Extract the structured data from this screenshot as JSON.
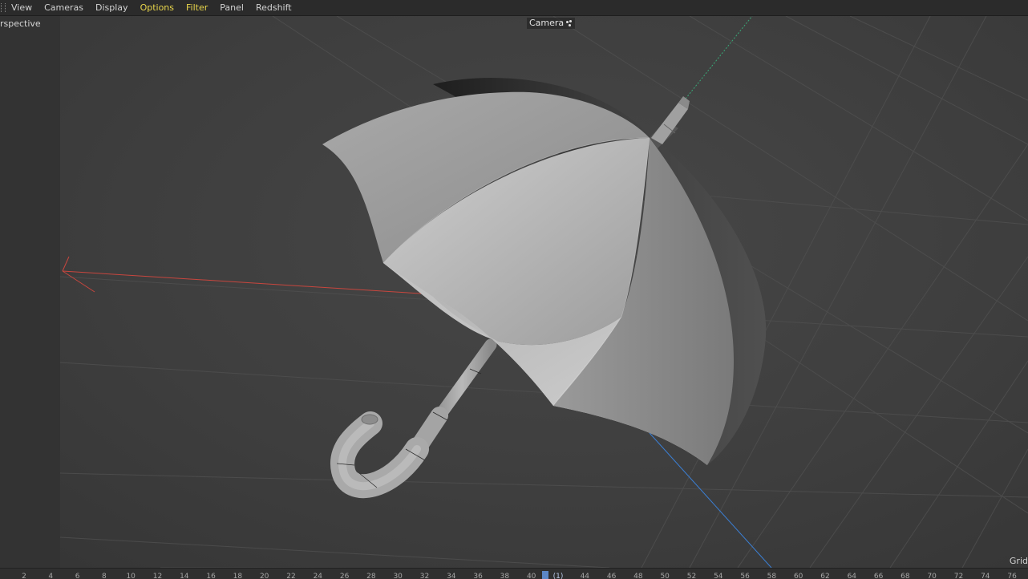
{
  "menu": {
    "items": [
      {
        "label": "View",
        "active": false
      },
      {
        "label": "Cameras",
        "active": false
      },
      {
        "label": "Display",
        "active": false
      },
      {
        "label": "Options",
        "active": true
      },
      {
        "label": "Filter",
        "active": true
      },
      {
        "label": "Panel",
        "active": false
      },
      {
        "label": "Redshift",
        "active": false
      }
    ]
  },
  "viewport": {
    "view_name": "rspective",
    "camera_label": "Camera",
    "grid_label": "Grid",
    "axis_colors": {
      "x": "#c8463e",
      "y": "#3aa878",
      "z": "#3b7fd4"
    }
  },
  "timeline": {
    "ticks": [
      "2",
      "4",
      "6",
      "8",
      "10",
      "12",
      "14",
      "16",
      "18",
      "20",
      "22",
      "24",
      "26",
      "28",
      "30",
      "32",
      "34",
      "36",
      "38",
      "40",
      "(1)",
      "44",
      "46",
      "48",
      "50",
      "52",
      "54",
      "56",
      "58",
      "60",
      "62",
      "64",
      "66",
      "68",
      "70",
      "72",
      "74",
      "76"
    ],
    "current_frame_label": "(1)",
    "accent": "#5b86c6"
  }
}
